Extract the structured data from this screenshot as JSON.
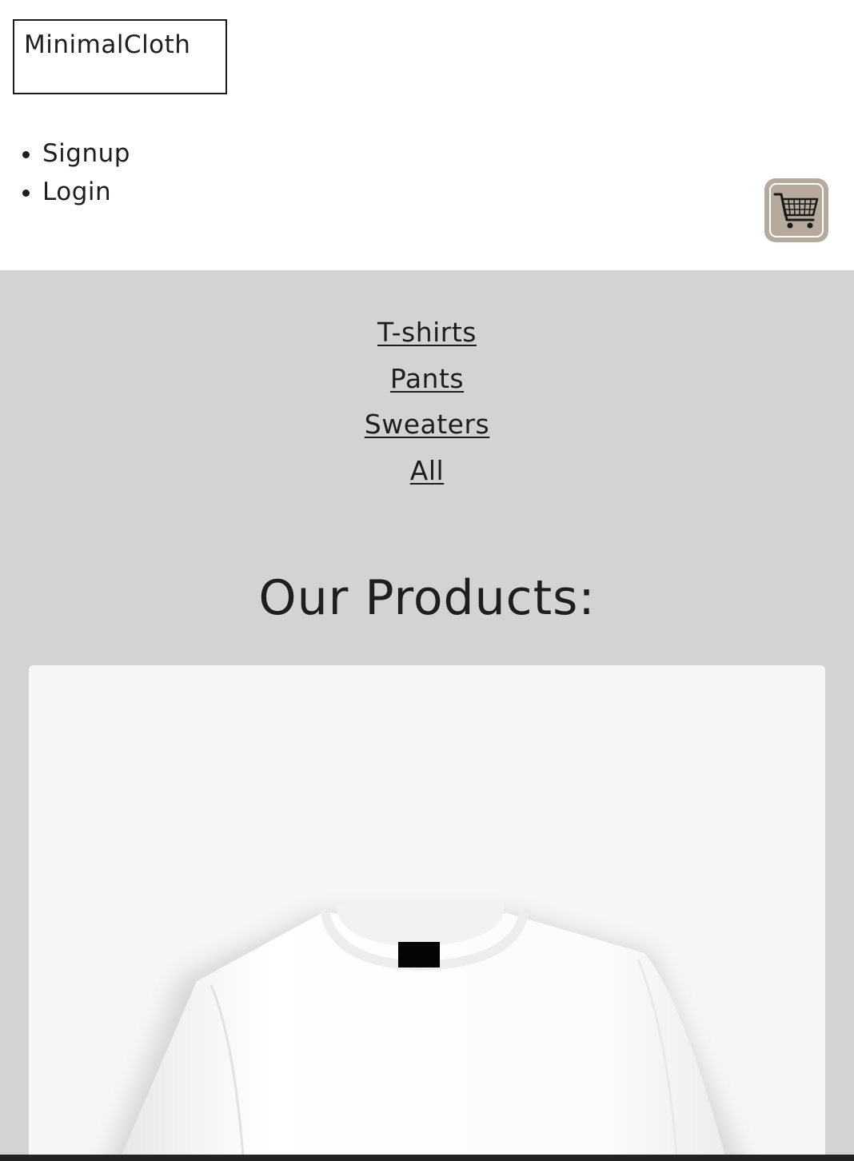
{
  "header": {
    "logo": "MinimalCloth",
    "auth_links": [
      {
        "label": "Signup"
      },
      {
        "label": "Login"
      }
    ],
    "cart": {
      "icon": "shopping-cart-icon"
    }
  },
  "categories": [
    {
      "label": "T-shirts"
    },
    {
      "label": "Pants"
    },
    {
      "label": "Sweaters"
    },
    {
      "label": "All"
    }
  ],
  "products": {
    "title": "Our Products:",
    "items": [
      {
        "image": "white-tshirt-image"
      }
    ]
  },
  "colors": {
    "page_background": "#ffffff",
    "content_background": "#d3d3d3",
    "cart_button": "#b5aa9b",
    "text": "#1e1e1e",
    "card_background": "#f6f6f6"
  }
}
